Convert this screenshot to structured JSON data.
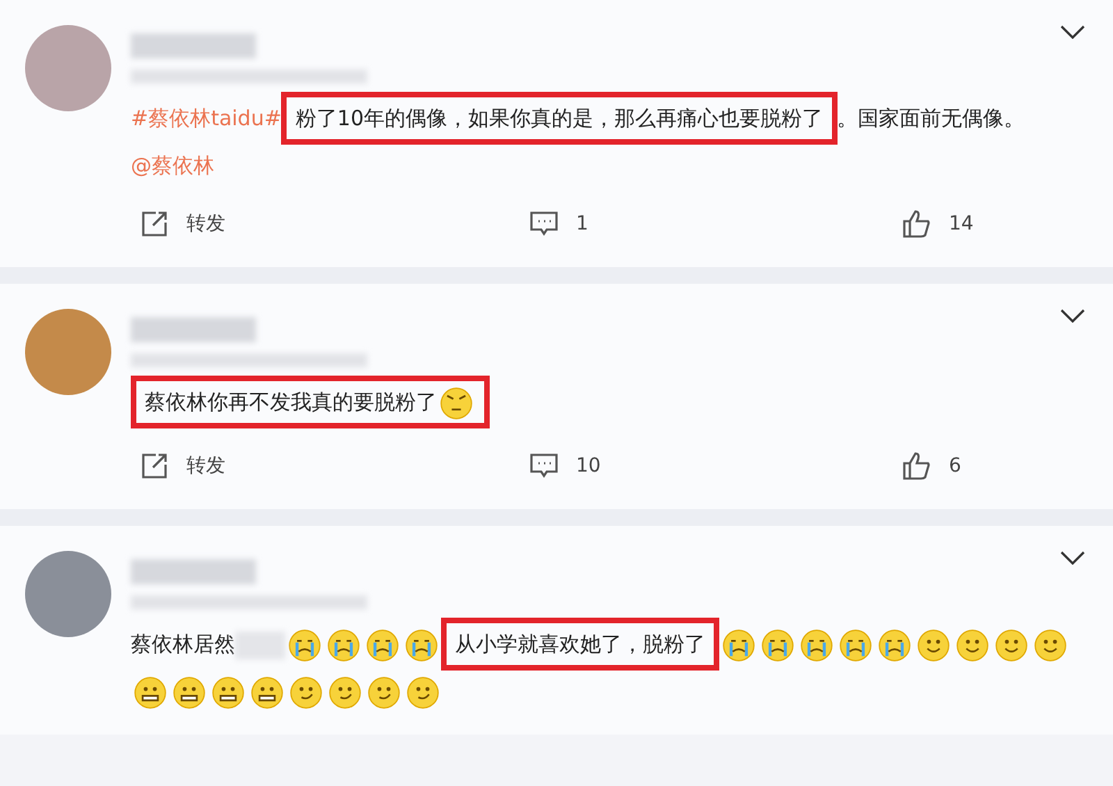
{
  "comments": [
    {
      "body": [
        {
          "kind": "hashtag",
          "text": "#蔡依林taidu#"
        },
        {
          "kind": "highlight",
          "parts": [
            {
              "kind": "text",
              "text": "粉了10年的偶像，如果你真的是，那么再痛心也要脱粉了"
            }
          ]
        },
        {
          "kind": "text",
          "text": "。国家面前无偶"
        },
        {
          "kind": "text",
          "text": "像。"
        },
        {
          "kind": "mention",
          "text": "@蔡依林"
        }
      ],
      "repost": "转发",
      "comment_count": "1",
      "like_count": "14"
    },
    {
      "body": [
        {
          "kind": "highlight",
          "parts": [
            {
              "kind": "text",
              "text": "蔡依林你再不发我真的要脱粉了"
            },
            {
              "kind": "emoji_angry"
            }
          ]
        }
      ],
      "repost": "转发",
      "comment_count": "10",
      "like_count": "6"
    },
    {
      "body": [
        {
          "kind": "text",
          "text": "蔡依林居然"
        },
        {
          "kind": "blur"
        },
        {
          "kind": "emoji_cry"
        },
        {
          "kind": "emoji_cry"
        },
        {
          "kind": "emoji_cry"
        },
        {
          "kind": "emoji_cry"
        },
        {
          "kind": "highlight",
          "parts": [
            {
              "kind": "text",
              "text": "从小学就喜欢她了，脱粉了"
            }
          ]
        },
        {
          "kind": "emoji_cry"
        },
        {
          "kind": "emoji_cry"
        },
        {
          "kind": "emoji_cry"
        },
        {
          "kind": "emoji_cry"
        },
        {
          "kind": "emoji_cry"
        },
        {
          "kind": "emoji_smile"
        },
        {
          "kind": "emoji_smile"
        },
        {
          "kind": "emoji_smile"
        },
        {
          "kind": "emoji_smile"
        },
        {
          "kind": "emoji_grimace"
        },
        {
          "kind": "emoji_grimace"
        },
        {
          "kind": "emoji_grimace"
        },
        {
          "kind": "emoji_grimace"
        },
        {
          "kind": "emoji_smirk"
        },
        {
          "kind": "emoji_smirk"
        },
        {
          "kind": "emoji_smirk"
        },
        {
          "kind": "emoji_smirk"
        }
      ]
    }
  ]
}
